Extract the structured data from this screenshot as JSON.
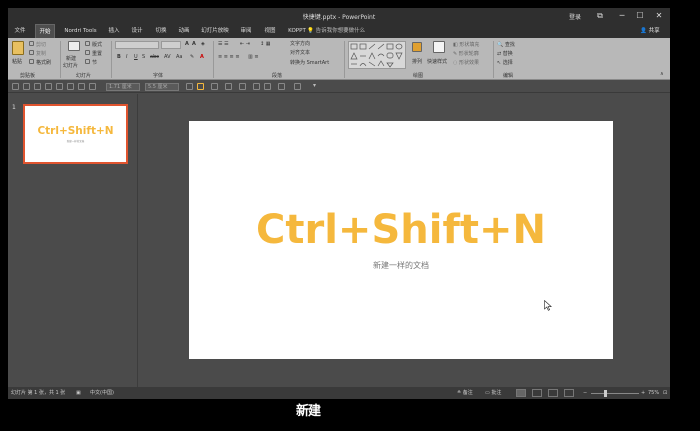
{
  "window": {
    "title": "快捷键.pptx - PowerPoint",
    "login": "登录",
    "controls": [
      "⧉",
      "─",
      "☐",
      "✕"
    ]
  },
  "menu": {
    "tabs": [
      {
        "label": "文件",
        "active": false
      },
      {
        "label": "开始",
        "active": true
      },
      {
        "label": "Nordri Tools",
        "active": false
      },
      {
        "label": "插入",
        "active": false
      },
      {
        "label": "设计",
        "active": false
      },
      {
        "label": "切换",
        "active": false
      },
      {
        "label": "动画",
        "active": false
      },
      {
        "label": "幻灯片放映",
        "active": false
      },
      {
        "label": "审阅",
        "active": false
      },
      {
        "label": "视图",
        "active": false
      },
      {
        "label": "KOPPT",
        "active": false
      }
    ],
    "search": "告诉我你想要做什么",
    "share": "共享"
  },
  "ribbon": {
    "groups": [
      "剪贴板",
      "幻灯片",
      "字体",
      "段落",
      "绘图",
      "编辑"
    ],
    "clipboard": {
      "paste": "粘贴",
      "cut": "剪切",
      "copy": "复制",
      "format_painter": "格式刷"
    },
    "slides": {
      "new_slide": "新建",
      "new_slide2": "幻灯片",
      "layout": "版式",
      "reset": "重置",
      "section": "节"
    },
    "paragraph": {
      "text_direction": "文字方向",
      "align_text": "对齐文本",
      "smartart": "转换为 SmartArt"
    },
    "drawing": {
      "arrange": "排列",
      "quick_styles": "快速样式",
      "shape_fill": "形状填充",
      "shape_outline": "形状轮廓",
      "shape_effects": "形状效果"
    },
    "editing": {
      "find": "查找",
      "replace": "替换",
      "select": "选择"
    }
  },
  "toolbar2": {
    "size1": "1.71 厘米",
    "size2": "5.5 厘米"
  },
  "thumbnail": {
    "number": "1",
    "title": "Ctrl+Shift+N",
    "subtitle": "新建一样的文档"
  },
  "slide": {
    "title": "Ctrl+Shift+N",
    "subtitle": "新建一样的文档"
  },
  "status": {
    "slide_info": "幻灯片 第 1 张，共 1 张",
    "language": "中文(中国)",
    "notes": "备注",
    "comments": "批注",
    "zoom": "75%"
  },
  "caption": "新建"
}
